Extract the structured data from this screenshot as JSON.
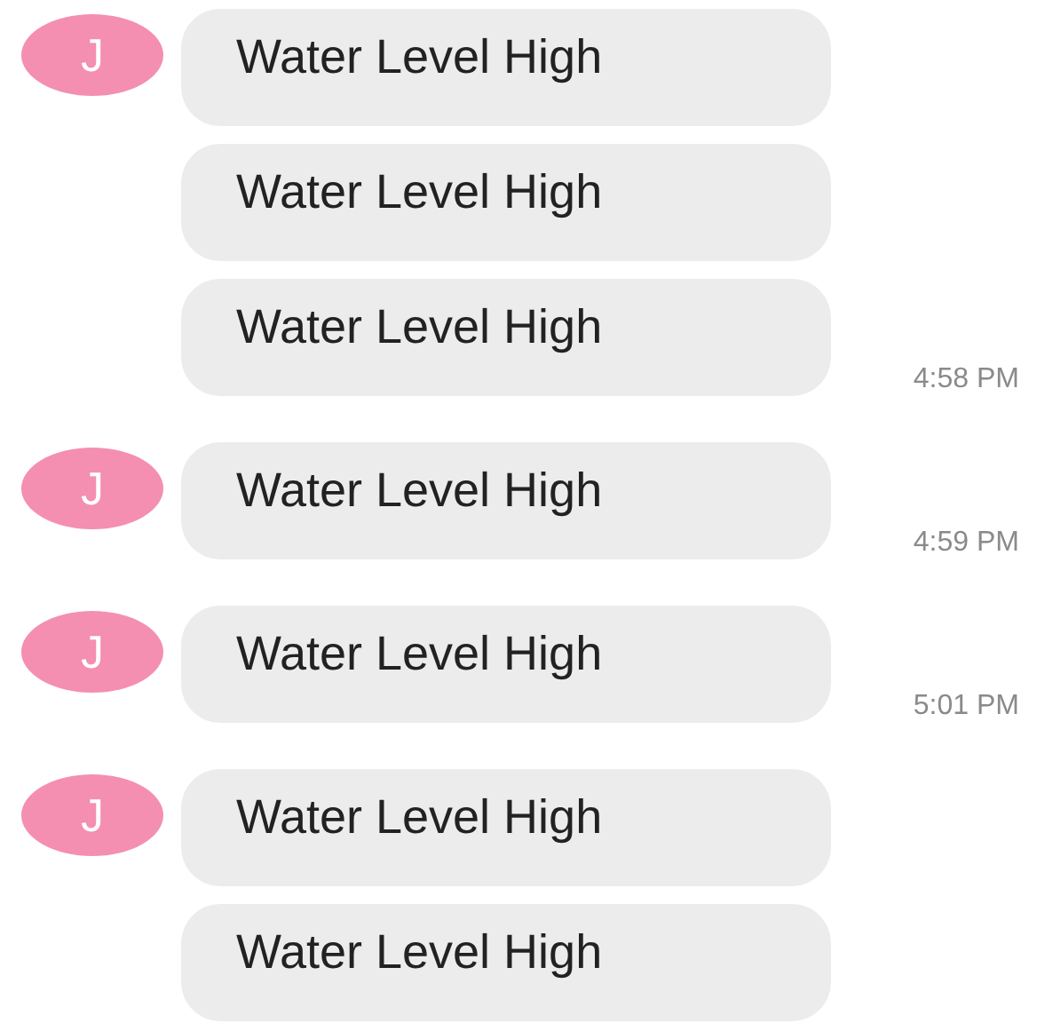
{
  "messages": [
    {
      "avatar": "J",
      "text": "Water Level High"
    },
    {
      "text": "Water Level High"
    },
    {
      "text": "Water Level High",
      "time": "4:58 PM"
    },
    {
      "avatar": "J",
      "text": "Water Level High",
      "time": "4:59 PM"
    },
    {
      "avatar": "J",
      "text": "Water Level High",
      "time": "5:01 PM"
    },
    {
      "avatar": "J",
      "text": "Water Level High"
    },
    {
      "text": "Water Level High"
    }
  ]
}
